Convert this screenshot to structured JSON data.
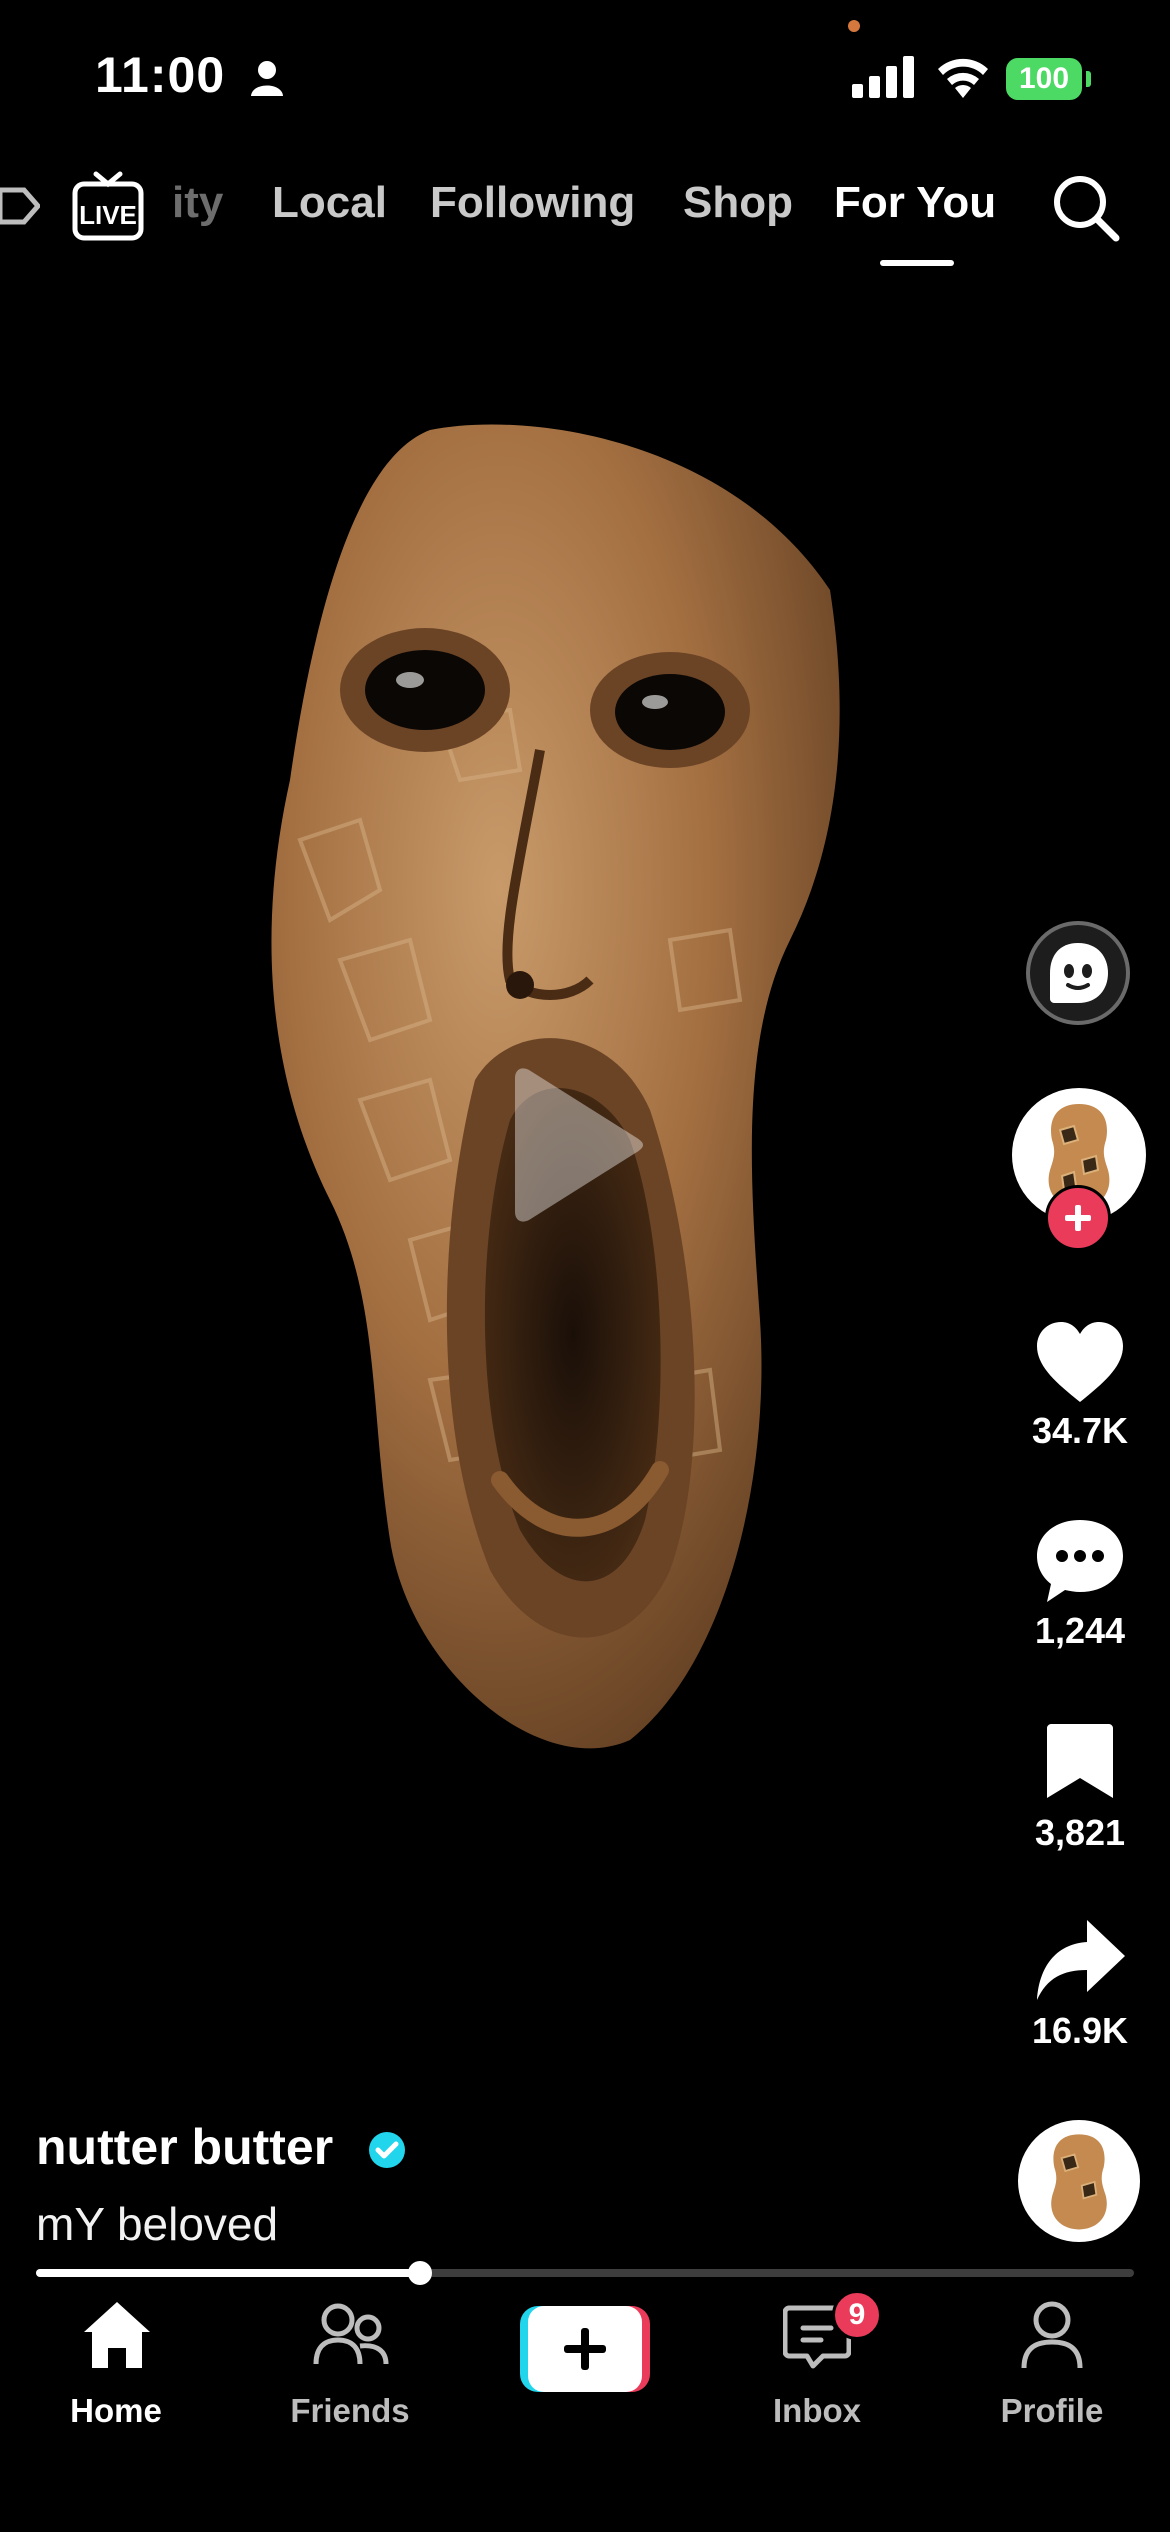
{
  "status_bar": {
    "time": "11:00",
    "battery": "100"
  },
  "top_tabs": {
    "live_label": "LIVE",
    "items": [
      "ity",
      "Local",
      "Following",
      "Shop",
      "For You"
    ],
    "active": "For You"
  },
  "video": {
    "progress_fraction": 0.35,
    "rail": {
      "likes": "34.7K",
      "comments": "1,244",
      "saves": "3,821",
      "shares": "16.9K"
    }
  },
  "caption": {
    "username": "nutter butter",
    "text": "mY beloved"
  },
  "bottom_nav": {
    "items": [
      "Home",
      "Friends",
      "Inbox",
      "Profile"
    ],
    "inbox_badge": "9",
    "active": "Home"
  },
  "colors": {
    "accent_red": "#ea3b5b",
    "battery_green": "#4cd964",
    "verified_blue": "#20d5ec"
  }
}
